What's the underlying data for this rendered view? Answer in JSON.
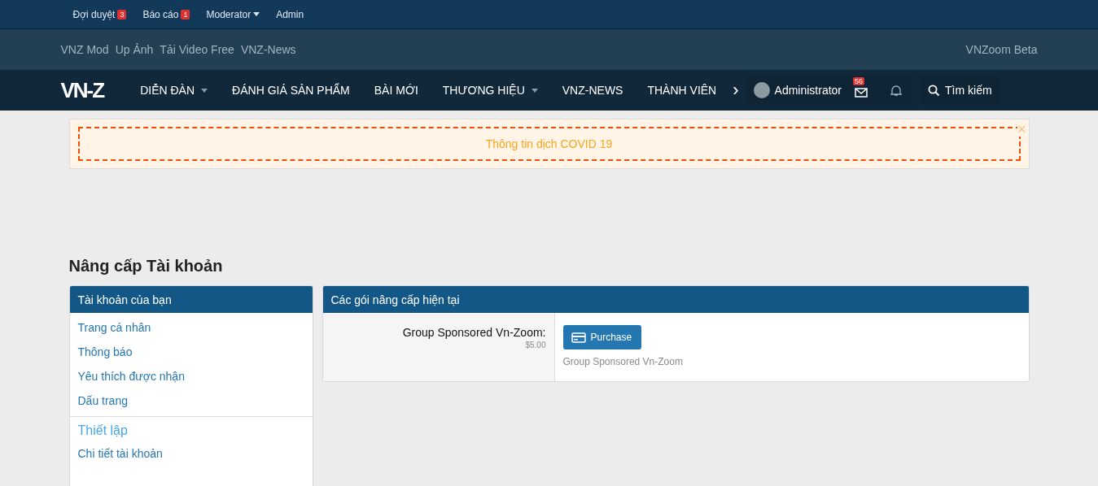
{
  "staff_bar": [
    {
      "label": "Đợi duyệt",
      "badge": "3",
      "has_menu": false
    },
    {
      "label": "Báo cáo",
      "badge": "1",
      "has_menu": false
    },
    {
      "label": "Moderator",
      "has_menu": true
    },
    {
      "label": "Admin",
      "has_menu": false
    }
  ],
  "links_bar": {
    "links": [
      "VNZ Mod",
      "Up Ảnh",
      "Tải Video Free",
      "VNZ-News"
    ],
    "right": "VNZoom Beta"
  },
  "nav": {
    "logo": "VN-Z",
    "items": [
      {
        "label": "DIỄN ĐÀN",
        "has_menu": true
      },
      {
        "label": "ĐÁNH GIÁ SẢN PHẨM",
        "has_menu": false
      },
      {
        "label": "BÀI MỚI",
        "has_menu": false
      },
      {
        "label": "THƯƠNG HIỆU",
        "has_menu": true
      },
      {
        "label": "VNZ-NEWS",
        "has_menu": false
      },
      {
        "label": "THÀNH VIÊN",
        "has_menu": false
      }
    ],
    "more": "›",
    "user": "Administrator",
    "inbox_badge": "56",
    "search": "Tìm kiếm"
  },
  "notice": {
    "text": "Thông tin dịch COVID 19",
    "close": "×"
  },
  "page_title": "Nâng cấp Tài khoản",
  "sidebar": {
    "title": "Tài khoản của bạn",
    "items": [
      {
        "kind": "link",
        "label": "Trang cá nhân"
      },
      {
        "kind": "link",
        "label": "Thông báo"
      },
      {
        "kind": "link",
        "label": "Yêu thích được nhận"
      },
      {
        "kind": "link",
        "label": "Dấu trang"
      },
      {
        "kind": "heading",
        "label": "Thiết lập"
      },
      {
        "kind": "link",
        "label": "Chi tiết tài khoản"
      }
    ]
  },
  "upgrades": {
    "title": "Các gói nâng cấp hiện tại",
    "rows": [
      {
        "name": "Group Sponsored Vn-Zoom:",
        "price": "$5.00",
        "button": "Purchase",
        "description": "Group Sponsored Vn-Zoom"
      }
    ]
  }
}
